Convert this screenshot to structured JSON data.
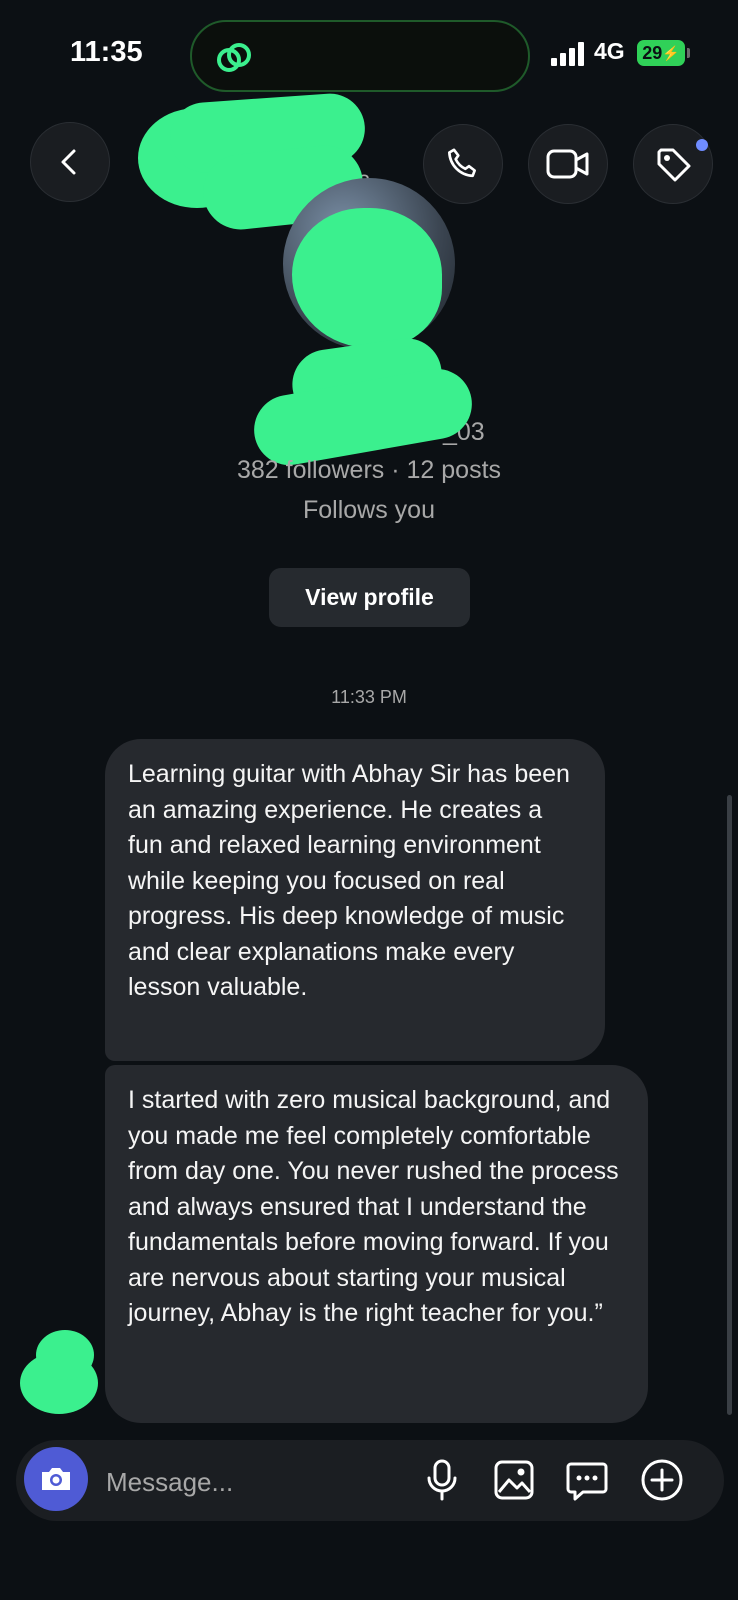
{
  "status_bar": {
    "time": "11:35",
    "network": "4G",
    "battery": "29"
  },
  "header": {
    "name_fragment": "3",
    "username_fragment": "_03"
  },
  "profile": {
    "stats": "382 followers · 12 posts",
    "follows_you": "Follows you",
    "view_profile_label": "View profile"
  },
  "thread": {
    "timestamp": "11:33 PM",
    "messages": [
      {
        "text": "Learning guitar with Abhay Sir has been an amazing experience. He creates a fun and relaxed learning environment while keeping you focused on real progress. His deep knowledge of music and clear explanations make every lesson valuable."
      },
      {
        "text": "I started with zero musical background, and you made me feel completely comfortable from day one. You never rushed the process and always ensured that I understand the fundamentals before moving forward. If you are nervous about starting your musical journey, Abhay is the right teacher for you.”"
      }
    ]
  },
  "composer": {
    "placeholder": "Message..."
  },
  "icons": [
    "threads-icon",
    "back-icon",
    "phone-icon",
    "video-icon",
    "tag-icon",
    "camera-icon",
    "microphone-icon",
    "gallery-icon",
    "sticker-icon",
    "plus-icon"
  ],
  "colors": {
    "background": "#0c1014",
    "bubble": "#26292e",
    "accent": "#4f5bd5",
    "battery": "#30d158",
    "redaction": "#3bf08e"
  }
}
